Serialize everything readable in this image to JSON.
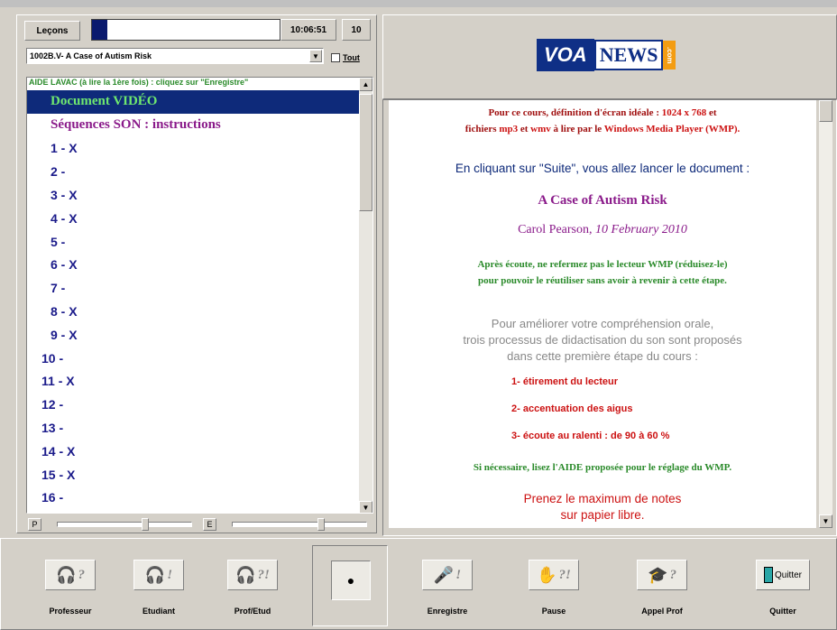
{
  "header": {
    "lecons_label": "Leçons",
    "progress_fraction": 0.08,
    "clock": "10:06:51",
    "counter": "10"
  },
  "lesson_select": {
    "value": "1002B.V- A Case of Autism Risk",
    "tout_label": "Tout"
  },
  "list": {
    "header": "AIDE LAVAC (à lire la 1ère fois) : cliquez sur \"Enregistre\"",
    "items": [
      {
        "label": "Document VIDÉO",
        "kind": "doc"
      },
      {
        "label": "Séquences SON : instructions",
        "kind": "son"
      },
      {
        "label": "1 - X",
        "kind": "num"
      },
      {
        "label": "2 -",
        "kind": "num"
      },
      {
        "label": "3 - X",
        "kind": "num"
      },
      {
        "label": "4 - X",
        "kind": "num"
      },
      {
        "label": "5 -",
        "kind": "num"
      },
      {
        "label": "6 - X",
        "kind": "num"
      },
      {
        "label": "7 -",
        "kind": "num"
      },
      {
        "label": "8 - X",
        "kind": "num"
      },
      {
        "label": "9 - X",
        "kind": "num"
      },
      {
        "label": "10 -",
        "kind": "big"
      },
      {
        "label": "11 - X",
        "kind": "big"
      },
      {
        "label": "12 -",
        "kind": "big"
      },
      {
        "label": "13 -",
        "kind": "big"
      },
      {
        "label": "14 - X",
        "kind": "big"
      },
      {
        "label": "15 - X",
        "kind": "big"
      },
      {
        "label": "16 -",
        "kind": "big"
      }
    ]
  },
  "sliders": {
    "p_label": "P",
    "e_label": "E",
    "p_level": 0.65,
    "e_level": 0.66
  },
  "logo": {
    "voa": "VOA",
    "news": "NEWS",
    "com": ".com"
  },
  "content": {
    "line1a": "Pour ce cours, définition d'écran idéale : ",
    "line1b": "1024 x 768",
    "line1c": " et",
    "line2a": "fichiers ",
    "line2b": "mp3",
    "line2c": " et ",
    "line2d": "wmv",
    "line2e": " à lire par le ",
    "line2f": "Windows Media Player (WMP).",
    "suite": "En cliquant sur \"Suite\", vous allez lancer le document :",
    "doc_title": "A Case of Autism Risk",
    "author": "Carol Pearson, ",
    "date": "10 February 2010",
    "wmp1": "Après écoute, ne refermez pas le lecteur WMP (réduisez-le)",
    "wmp2": "pour pouvoir le réutiliser sans avoir à revenir à cette étape.",
    "improve1": "Pour améliorer votre compréhension orale,",
    "improve2": "trois  processus de didactisation du son sont proposés",
    "improve3": "dans cette première étape du cours :",
    "step1": "1- étirement du lecteur",
    "step2": "2- accentuation des aigus",
    "step3": "3- écoute au ralenti : de 90 à 60 %",
    "aide": "Si nécessaire, lisez l'AIDE proposée pour le réglage du WMP.",
    "notes1": "Prenez le maximum de notes",
    "notes2": "sur papier libre."
  },
  "toolbar": {
    "professeur": "Professeur",
    "etudiant": "Etudiant",
    "prof_etud": "Prof/Etud",
    "enregistre": "Enregistre",
    "pause": "Pause",
    "appel_prof": "Appel Prof",
    "quitter": "Quitter",
    "quitter_icon_text": "Quitter"
  },
  "colors": {
    "navy": "#0e2a7a",
    "green": "#2a8a2a",
    "red": "#cc1111",
    "purple": "#8a1a8a",
    "darkred": "#a01010"
  }
}
